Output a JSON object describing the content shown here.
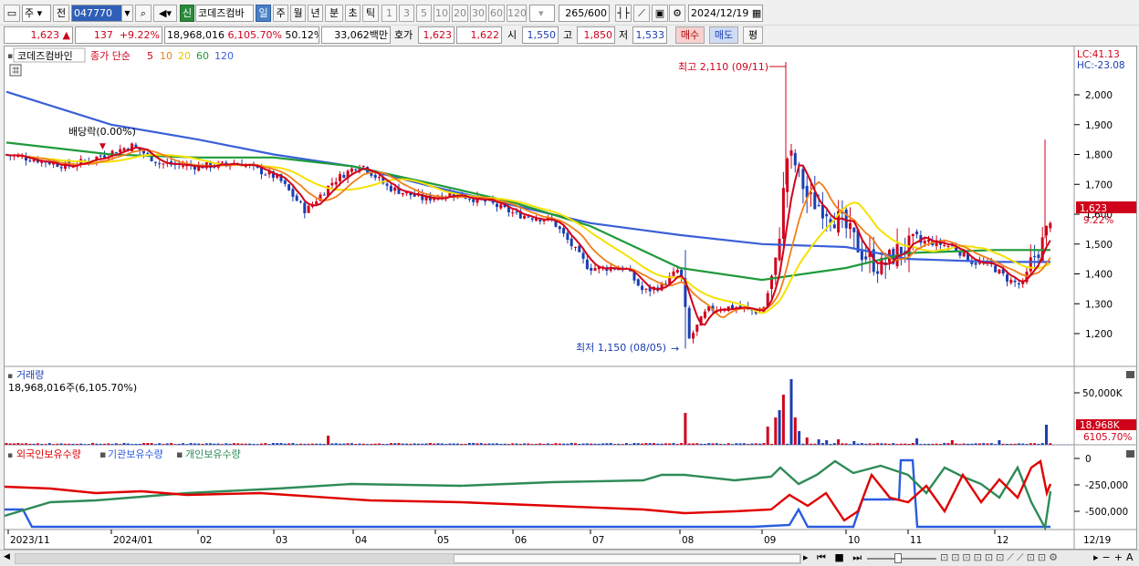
{
  "toolbar": {
    "type_select": "주",
    "prev_label": "전",
    "code_value": "047770",
    "new_badge": "신",
    "stock_name": "코데즈컴바",
    "periods": [
      "일",
      "주",
      "월",
      "년",
      "분",
      "초",
      "틱"
    ],
    "period_selected": "일",
    "minutes": [
      "1",
      "3",
      "5",
      "10",
      "20",
      "30",
      "60",
      "120"
    ],
    "count_value": "265",
    "count_total": "/600",
    "date_value": "2024/12/19"
  },
  "quote": {
    "price": "1,623",
    "change": "137",
    "change_pct": "+9.22%",
    "volume": "18,968,016",
    "volume_pct": "6,105.70%",
    "turnover": "50.12%",
    "amount": "33,062백만",
    "ask_label": "호가",
    "ask": "1,623",
    "bid": "1,622",
    "open_label": "시",
    "open": "1,550",
    "high_label": "고",
    "high": "1,850",
    "low_label": "저",
    "low": "1,533",
    "buy_label": "매수",
    "sell_label": "매도",
    "eval_label": "평"
  },
  "price_panel": {
    "title": "코데즈컴바인",
    "ma_title": "종가 단순",
    "ma_periods": [
      "5",
      "10",
      "20",
      "60",
      "120"
    ],
    "lc": "LC:41.13",
    "hc": "HC:-23.08",
    "y_ticks": [
      "2,000",
      "1,900",
      "1,800",
      "1,700",
      "1,600",
      "1,500",
      "1,400",
      "1,300",
      "1,200"
    ],
    "current_price_tag": "1,623",
    "current_pct_tag": "9.22%",
    "high_annotation": "최고 2,110 (09/11)",
    "low_annotation": "최저 1,150 (08/05)",
    "dividend_annotation": "배당락(0.00%)"
  },
  "volume_panel": {
    "title": "거래량",
    "subtitle": "18,968,016주(6,105.70%)",
    "y_tick": "50,000K",
    "tag1": "18,968K",
    "tag2": "6105.70%"
  },
  "holdings_panel": {
    "legend": [
      "외국인보유수량",
      "기관보유수량",
      "개인보유수량"
    ],
    "y_ticks": [
      "0",
      "-250,000",
      "-500,000"
    ]
  },
  "x_axis": {
    "labels": [
      "2023/11",
      "2024/01",
      "02",
      "03",
      "04",
      "05",
      "06",
      "07",
      "08",
      "09",
      "10",
      "11",
      "12"
    ],
    "end_label": "12/19"
  },
  "colors": {
    "up": "#d0021b",
    "down": "#1a3fb0",
    "ma5": "#d0021b",
    "ma10": "#f07f1a",
    "ma20": "#f5e100",
    "ma60": "#1f9a3a",
    "ma120": "#3a5fd8",
    "foreign": "#e00000",
    "institution": "#2a5ce0",
    "individual": "#2e8b57"
  },
  "chart_data": {
    "type": "line",
    "title": "코데즈컴바인",
    "ylim": [
      1150,
      2110
    ],
    "x": [
      "2023/11",
      "2024/01",
      "02",
      "03",
      "04",
      "05",
      "06",
      "07",
      "08",
      "09",
      "10",
      "11",
      "12",
      "12/19"
    ],
    "series": [
      {
        "name": "5",
        "values": [
          1790,
          1810,
          1770,
          1740,
          1760,
          1650,
          1600,
          1450,
          1380,
          1700,
          1450,
          1470,
          1400,
          1520
        ]
      },
      {
        "name": "60",
        "values": [
          1840,
          1800,
          1790,
          1790,
          1760,
          1700,
          1640,
          1560,
          1420,
          1380,
          1420,
          1470,
          1480,
          1480
        ]
      },
      {
        "name": "120",
        "values": [
          2010,
          1900,
          1850,
          1800,
          1760,
          1690,
          1630,
          1570,
          1530,
          1500,
          1490,
          1450,
          1440,
          1440
        ]
      }
    ]
  }
}
